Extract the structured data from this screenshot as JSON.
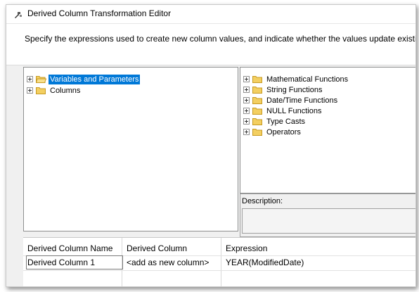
{
  "window": {
    "title": "Derived Column Transformation Editor"
  },
  "header": {
    "instruction": "Specify the expressions used to create new column values, and indicate whether the values update existing co"
  },
  "left_tree": {
    "items": [
      {
        "label": "Variables and Parameters",
        "selected": true
      },
      {
        "label": "Columns",
        "selected": false
      }
    ]
  },
  "right_tree": {
    "items": [
      {
        "label": "Mathematical Functions"
      },
      {
        "label": "String Functions"
      },
      {
        "label": "Date/Time Functions"
      },
      {
        "label": "NULL Functions"
      },
      {
        "label": "Type Casts"
      },
      {
        "label": "Operators"
      }
    ]
  },
  "description": {
    "label": "Description:",
    "value": ""
  },
  "grid": {
    "headers": [
      "Derived Column Name",
      "Derived Column",
      "Expression"
    ],
    "rows": [
      [
        "Derived Column 1",
        "<add as new column>",
        "YEAR(ModifiedDate)"
      ]
    ]
  },
  "colors": {
    "selection": "#0078d7",
    "folder_fill": "#f3cf61",
    "folder_edge": "#c79a22",
    "frame_bg": "#f0f0f0"
  },
  "icons": {
    "title_icon": "transformation-icon",
    "tree_folder": "folder-icon",
    "expander": "plus-expander-icon"
  }
}
